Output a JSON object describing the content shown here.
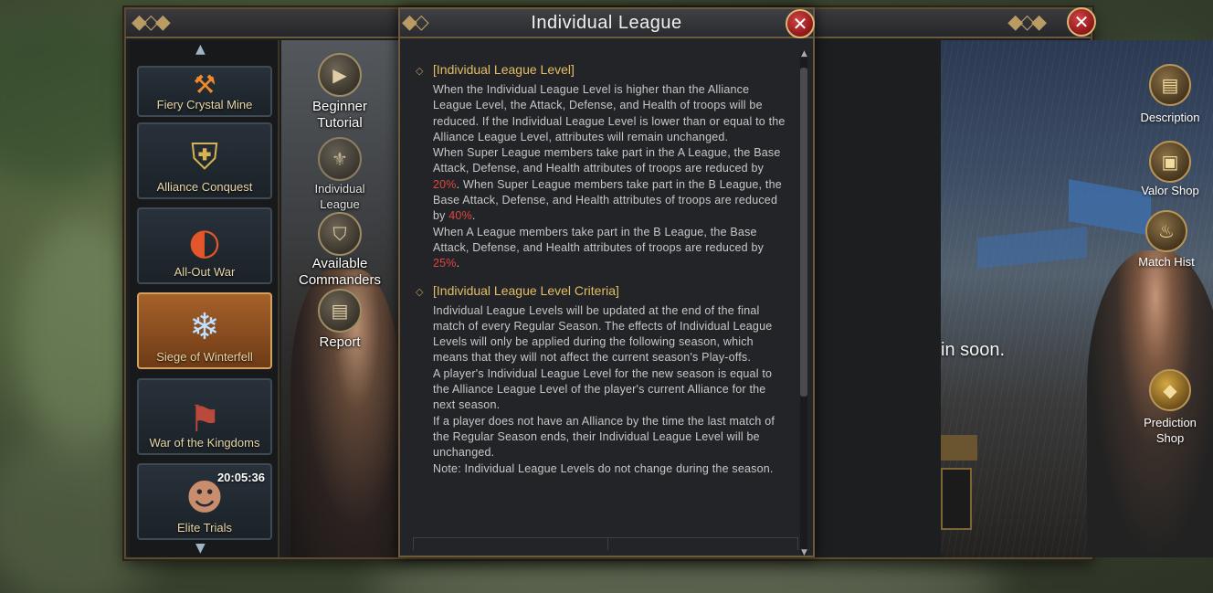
{
  "dialog": {
    "title": "Individual League",
    "sections": [
      {
        "heading": "[Individual League Level]",
        "paragraphs": {
          "p1": "When the Individual League Level is higher than the Alliance League Level, the Attack, Defense, and Health of troops will be reduced. If the Individual League Level is lower than or equal to the Alliance League Level, attributes will remain unchanged.",
          "p2a": "When Super League members take part in the A League, the Base Attack, Defense, and Health attributes of troops are reduced by ",
          "p2b": "20%",
          "p2c": ". When Super League members take part in the B League, the Base Attack, Defense, and Health attributes of troops are reduced by ",
          "p2d": "40%",
          "p2e": ".",
          "p3a": "When A League members take part in the B League, the Base Attack, Defense, and Health attributes of troops are reduced by ",
          "p3b": "25%",
          "p3c": "."
        }
      },
      {
        "heading": "[Individual League Level Criteria]",
        "paragraphs": {
          "p1": "Individual League Levels will be updated at the end of the final match of every Regular Season. The effects of Individual League Levels will only be applied during the following season, which means that they will not affect the current season's Play-offs.",
          "p2": "A player's Individual League Level for the new season is equal to the Alliance League Level of the player's current Alliance for the next season.",
          "p3": "If a player does not have an Alliance by the time the last match of the Regular Season ends, their Individual League Level will be unchanged.",
          "p4": "Note: Individual League Levels do not change during the season."
        }
      }
    ],
    "highlight_color": "#e2453f",
    "heading_color": "#e5bd64"
  },
  "events": [
    {
      "label": "Fiery Crystal Mine",
      "icon": "crystal-mine-icon"
    },
    {
      "label": "Alliance Conquest",
      "icon": "alliance-crest-icon"
    },
    {
      "label": "All-Out War",
      "icon": "war-orb-icon"
    },
    {
      "label": "Siege of Winterfell",
      "icon": "snowflake-icon"
    },
    {
      "label": "War of the Kingdoms",
      "icon": "banner-icon"
    },
    {
      "label": "Elite Trials",
      "icon": "portrait-icon",
      "timer": "20:05:36"
    }
  ],
  "nav": [
    {
      "label": "Beginner Tutorial",
      "icon": "play-icon"
    },
    {
      "label": "Individual League",
      "icon": "fleur-icon"
    },
    {
      "label": "Available Commanders",
      "icon": "shield-icon"
    },
    {
      "label": "Report",
      "icon": "book-icon"
    }
  ],
  "side": [
    {
      "label": "Description",
      "icon": "book-icon"
    },
    {
      "label": "Valor Shop",
      "icon": "chest-icon"
    },
    {
      "label": "Match Hist",
      "icon": "flame-icon"
    },
    {
      "label": "Prediction Shop",
      "icon": "treasure-icon"
    }
  ],
  "background_text": "in soon."
}
